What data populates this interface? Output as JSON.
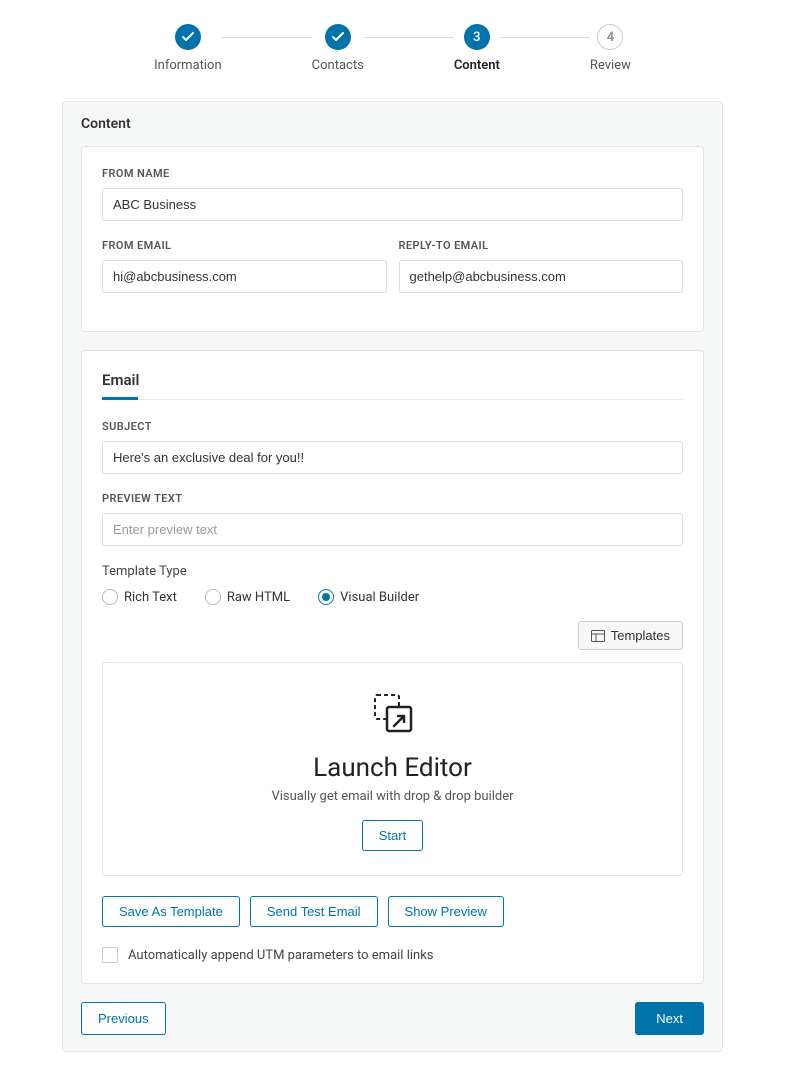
{
  "stepper": {
    "steps": [
      {
        "label": "Information",
        "indicator": "✓",
        "state": "done"
      },
      {
        "label": "Contacts",
        "indicator": "✓",
        "state": "done"
      },
      {
        "label": "Content",
        "indicator": "3",
        "state": "active"
      },
      {
        "label": "Review",
        "indicator": "4",
        "state": "upcoming"
      }
    ]
  },
  "panel": {
    "title": "Content"
  },
  "from": {
    "name_label": "FROM NAME",
    "name_value": "ABC Business",
    "email_label": "FROM EMAIL",
    "email_value": "hi@abcbusiness.com",
    "reply_label": "REPLY-TO EMAIL",
    "reply_value": "gethelp@abcbusiness.com"
  },
  "email": {
    "tab_label": "Email",
    "subject_label": "SUBJECT",
    "subject_value": "Here's an exclusive deal for you!!",
    "preview_label": "PREVIEW TEXT",
    "preview_placeholder": "Enter preview text",
    "template_type_label": "Template Type",
    "template_options": {
      "rich": "Rich Text",
      "raw": "Raw HTML",
      "visual": "Visual Builder"
    },
    "template_selected": "visual",
    "templates_button": "Templates",
    "launch": {
      "title": "Launch Editor",
      "sub": "Visually get email with drop & drop builder",
      "start": "Start"
    },
    "actions": {
      "save_template": "Save As Template",
      "send_test": "Send Test Email",
      "show_preview": "Show Preview"
    },
    "utm_checkbox_label": "Automatically append UTM parameters to email links",
    "utm_checked": false
  },
  "footer": {
    "previous": "Previous",
    "next": "Next"
  },
  "colors": {
    "primary": "#0073aa"
  }
}
